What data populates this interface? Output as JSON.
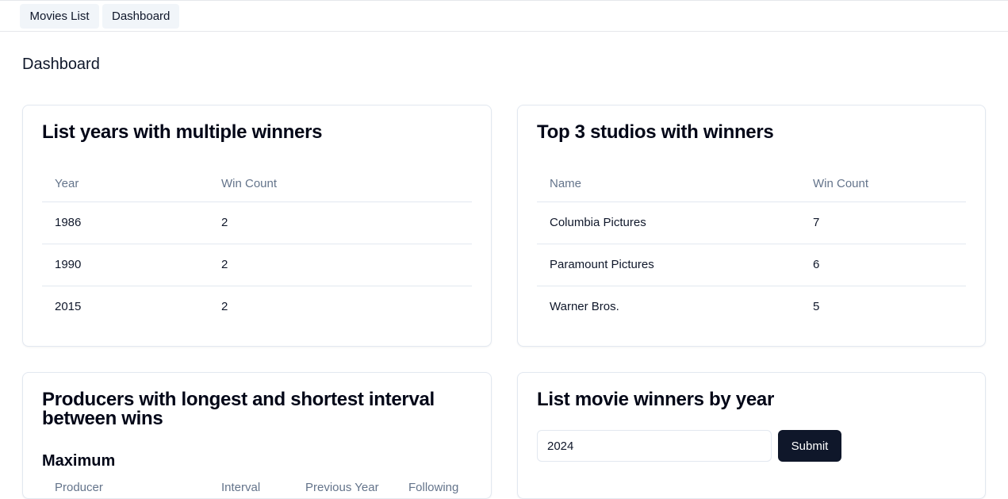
{
  "nav": {
    "movies_list": "Movies List",
    "dashboard": "Dashboard"
  },
  "page": {
    "title": "Dashboard"
  },
  "years_card": {
    "title": "List years with multiple winners",
    "headers": [
      "Year",
      "Win Count"
    ],
    "rows": [
      [
        "1986",
        "2"
      ],
      [
        "1990",
        "2"
      ],
      [
        "2015",
        "2"
      ]
    ]
  },
  "studios_card": {
    "title": "Top 3 studios with winners",
    "headers": [
      "Name",
      "Win Count"
    ],
    "rows": [
      [
        "Columbia Pictures",
        "7"
      ],
      [
        "Paramount Pictures",
        "6"
      ],
      [
        "Warner Bros.",
        "5"
      ]
    ]
  },
  "producers_card": {
    "title": "Producers with longest and shortest interval between wins",
    "maximum_label": "Maximum",
    "headers": [
      "Producer",
      "Interval",
      "Previous Year",
      "Following"
    ]
  },
  "winners_card": {
    "title": "List movie winners by year",
    "year_value": "2024",
    "submit_label": "Submit"
  },
  "colors": {
    "accent": "#0f172a",
    "nav_button_bg": "#f1f5f9",
    "border": "#e2e8f0",
    "muted_text": "#64748b"
  }
}
